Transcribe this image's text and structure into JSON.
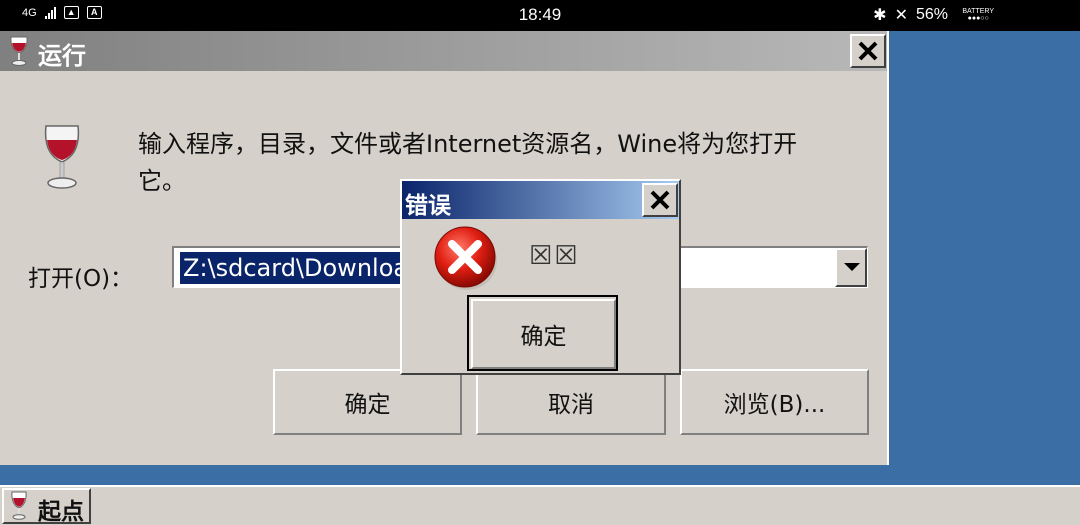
{
  "status_bar": {
    "network": "4G",
    "time": "18:49",
    "battery_percent": "56%",
    "battery_label": "BATTERY"
  },
  "run_dialog": {
    "title": "运行",
    "description": "输入程序，目录，文件或者Internet资源名，Wine将为您打开它。",
    "open_label": "打开(O)：",
    "path_value": "Z:\\sdcard\\Download",
    "ok_label": "确定",
    "cancel_label": "取消",
    "browse_label": "浏览(B)..."
  },
  "error_dialog": {
    "title": "错误",
    "message": "☒☒",
    "ok_label": "确定"
  },
  "taskbar": {
    "start_label": "起点"
  },
  "icons": [
    "wine-glass-icon",
    "close-icon",
    "error-icon",
    "dropdown-arrow-icon"
  ]
}
